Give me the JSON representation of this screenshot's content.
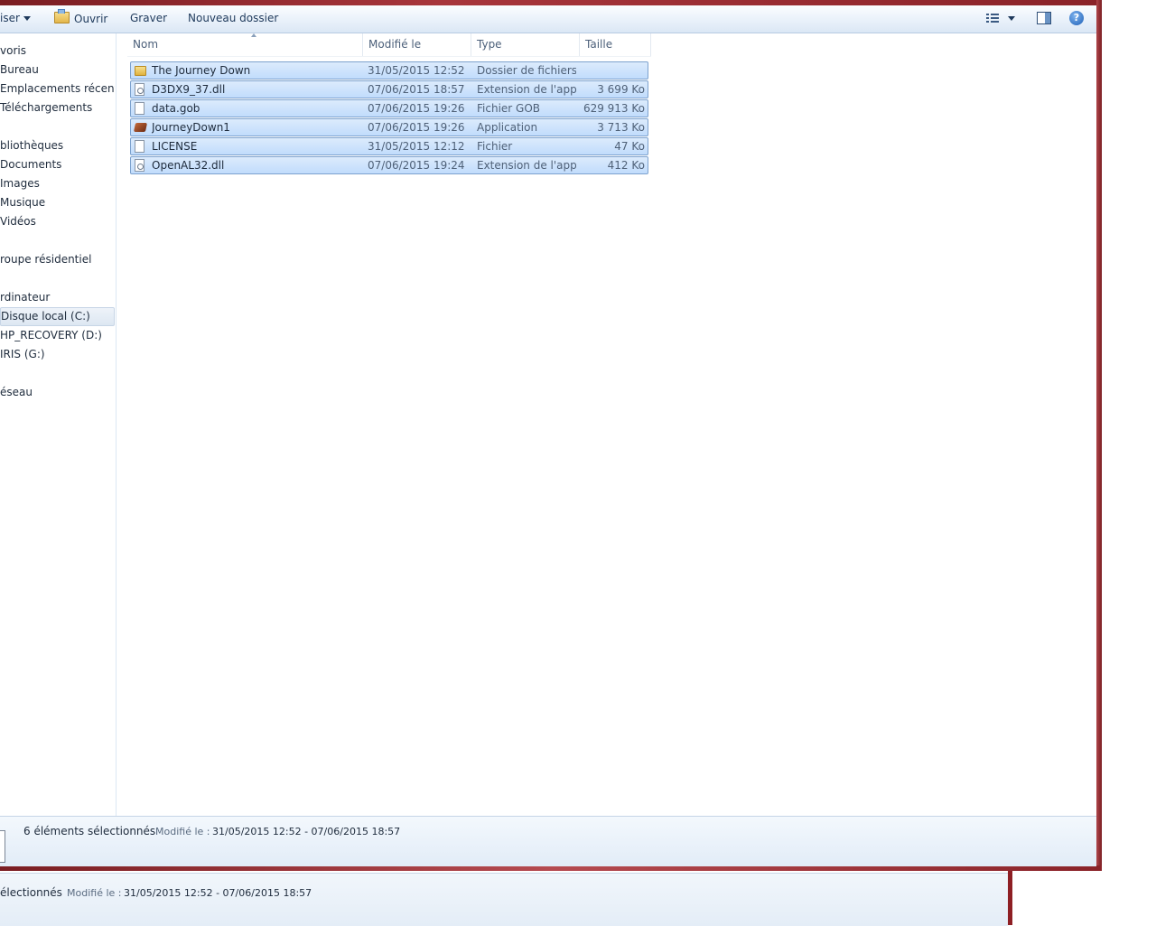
{
  "toolbar": {
    "organize_label": "iser",
    "open_label": "Ouvrir",
    "burn_label": "Graver",
    "new_folder_label": "Nouveau dossier",
    "help_label": "?"
  },
  "navigation": {
    "items": [
      {
        "label": "voris"
      },
      {
        "label": "Bureau"
      },
      {
        "label": "Emplacements récents"
      },
      {
        "label": "Téléchargements"
      },
      {
        "label": "bliothèques"
      },
      {
        "label": "Documents"
      },
      {
        "label": "Images"
      },
      {
        "label": "Musique"
      },
      {
        "label": "Vidéos"
      },
      {
        "label": "roupe résidentiel"
      },
      {
        "label": "rdinateur"
      },
      {
        "label": "Disque local (C:)"
      },
      {
        "label": "HP_RECOVERY (D:)"
      },
      {
        "label": "IRIS (G:)"
      },
      {
        "label": "éseau"
      }
    ],
    "selected": "Disque local (C:)"
  },
  "columns": {
    "name": "Nom",
    "modified": "Modifié le",
    "type": "Type",
    "size": "Taille"
  },
  "files": [
    {
      "name": "The Journey Down",
      "modified": "31/05/2015 12:52",
      "type": "Dossier de fichiers",
      "size": "",
      "icon": "folder-icon"
    },
    {
      "name": "D3DX9_37.dll",
      "modified": "07/06/2015 18:57",
      "type": "Extension de l'app...",
      "size": "3 699 Ko",
      "icon": "dll-file-icon"
    },
    {
      "name": "data.gob",
      "modified": "07/06/2015 19:26",
      "type": "Fichier GOB",
      "size": "629 913 Ko",
      "icon": "file-icon"
    },
    {
      "name": "JourneyDown1",
      "modified": "07/06/2015 19:26",
      "type": "Application",
      "size": "3 713 Ko",
      "icon": "application-icon"
    },
    {
      "name": "LICENSE",
      "modified": "31/05/2015 12:12",
      "type": "Fichier",
      "size": "47 Ko",
      "icon": "file-icon"
    },
    {
      "name": "OpenAL32.dll",
      "modified": "07/06/2015 19:24",
      "type": "Extension de l'app...",
      "size": "412 Ko",
      "icon": "dll-file-icon"
    }
  ],
  "status": {
    "selection_count": "6 éléments sélectionnés",
    "modified_label": "Modifié le :",
    "modified_range": "31/05/2015 12:52 - 07/06/2015 18:57"
  },
  "background_window": {
    "selection_count": "électionnés",
    "modified_label": "Modifié le :",
    "modified_range": "31/05/2015 12:52 - 07/06/2015 18:57"
  },
  "colors": {
    "frame": "#8e1f24",
    "selection_fill": "#c9e0fc",
    "selection_border": "#7da2ce",
    "text_primary": "#1e2b3c"
  }
}
